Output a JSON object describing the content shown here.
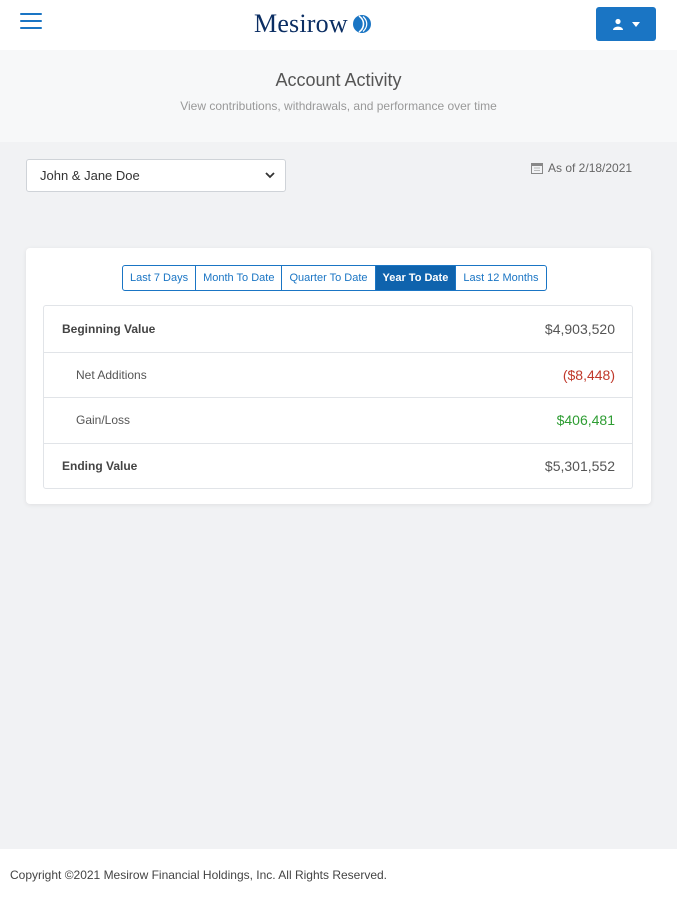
{
  "header": {
    "logo_text": "Mesirow"
  },
  "page": {
    "title": "Account Activity",
    "subtitle": "View contributions, withdrawals, and performance over time"
  },
  "account_select": {
    "selected": "John & Jane Doe"
  },
  "as_of": "As of 2/18/2021",
  "tabs": [
    {
      "label": "Last 7 Days",
      "active": false
    },
    {
      "label": "Month To Date",
      "active": false
    },
    {
      "label": "Quarter To Date",
      "active": false
    },
    {
      "label": "Year To Date",
      "active": true
    },
    {
      "label": "Last 12 Months",
      "active": false
    }
  ],
  "summary": {
    "beginning": {
      "label": "Beginning Value",
      "value": "$4,903,520"
    },
    "net_additions": {
      "label": "Net Additions",
      "value": "($8,448)"
    },
    "gain_loss": {
      "label": "Gain/Loss",
      "value": "$406,481"
    },
    "ending": {
      "label": "Ending Value",
      "value": "$5,301,552"
    }
  },
  "colors": {
    "brand": "#0b2e63",
    "accent": "#1a75c4",
    "negative": "#c0392b",
    "positive": "#2e9d33"
  },
  "footer": {
    "copyright": "Copyright ©2021 Mesirow Financial Holdings, Inc. All Rights Reserved."
  }
}
